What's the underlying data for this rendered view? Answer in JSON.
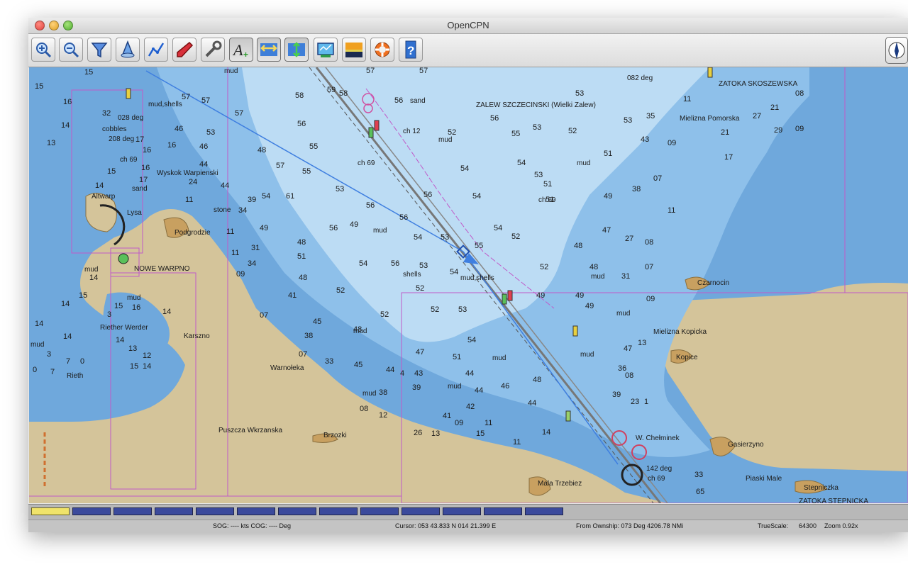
{
  "window": {
    "title": "OpenCPN"
  },
  "toolbar": {
    "buttons": [
      {
        "name": "zoom-in-button",
        "icon": "zoom-in-icon"
      },
      {
        "name": "zoom-out-button",
        "icon": "zoom-out-icon"
      },
      {
        "name": "chart-scale-button",
        "icon": "funnel-icon"
      },
      {
        "name": "settings-waypoint-button",
        "icon": "marker-icon"
      },
      {
        "name": "route-button",
        "icon": "route-icon"
      },
      {
        "name": "follow-ship-button",
        "icon": "ship-icon"
      },
      {
        "name": "toolbox-button",
        "icon": "wrench-icon"
      },
      {
        "name": "text-toggle-button",
        "icon": "text-icon"
      },
      {
        "name": "current-button",
        "icon": "current-icon"
      },
      {
        "name": "tide-button",
        "icon": "tide-icon"
      },
      {
        "name": "print-button",
        "icon": "print-icon"
      },
      {
        "name": "night-mode-button",
        "icon": "sunset-icon"
      },
      {
        "name": "mob-button",
        "icon": "lifebuoy-icon"
      },
      {
        "name": "help-button",
        "icon": "help-icon"
      }
    ],
    "compass_icon": "compass-icon"
  },
  "chart": {
    "place_names": [
      "ZALEW SZCZECINSKI (Wielki Zalew)",
      "ZATOKA SKOSZEWSKA",
      "Mielizna Pomorska",
      "Wyskok Warpienski",
      "Altwarp",
      "Lysa",
      "Podgrodzie",
      "NOWE WARPNO",
      "Riether Werder",
      "Karszno",
      "Rieth",
      "Warnołeka",
      "Puszcza Wkrzanska",
      "Brzozki",
      "Czarnocin",
      "Mielizna Kopicka",
      "Kopice",
      "W. Chełminek",
      "Gasierzyno",
      "Mala Trzebiez",
      "Piaski Male",
      "Stepniczka",
      "ZATOKA STEPNICKA"
    ],
    "seabed_labels": [
      "mud,shells",
      "cobbles",
      "sand",
      "mud",
      "stone",
      "shells",
      "mud,shells"
    ],
    "course_labels": [
      "028 deg",
      "208 deg",
      "082 deg",
      "142 deg",
      "ch 69",
      "ch 12"
    ],
    "colors": {
      "land": "#d4c49a",
      "shallow": "#6fa8dc",
      "medium": "#8ec0ea",
      "deep": "#bcdcf4",
      "route": "#3f7fe0",
      "boundary": "#c05ac8"
    }
  },
  "piano": {
    "count": 13,
    "active_index": 0
  },
  "status": {
    "sog_cog": "SOG: ---- kts  COG: ---- Deg",
    "cursor": "Cursor: 053 43.833 N 014 21.399 E",
    "from_ownship": "From Ownship: 073 Deg  4206.78 NMi",
    "truescale_label": "TrueScale:",
    "truescale_value": "64300",
    "zoom": "Zoom 0.92x"
  }
}
